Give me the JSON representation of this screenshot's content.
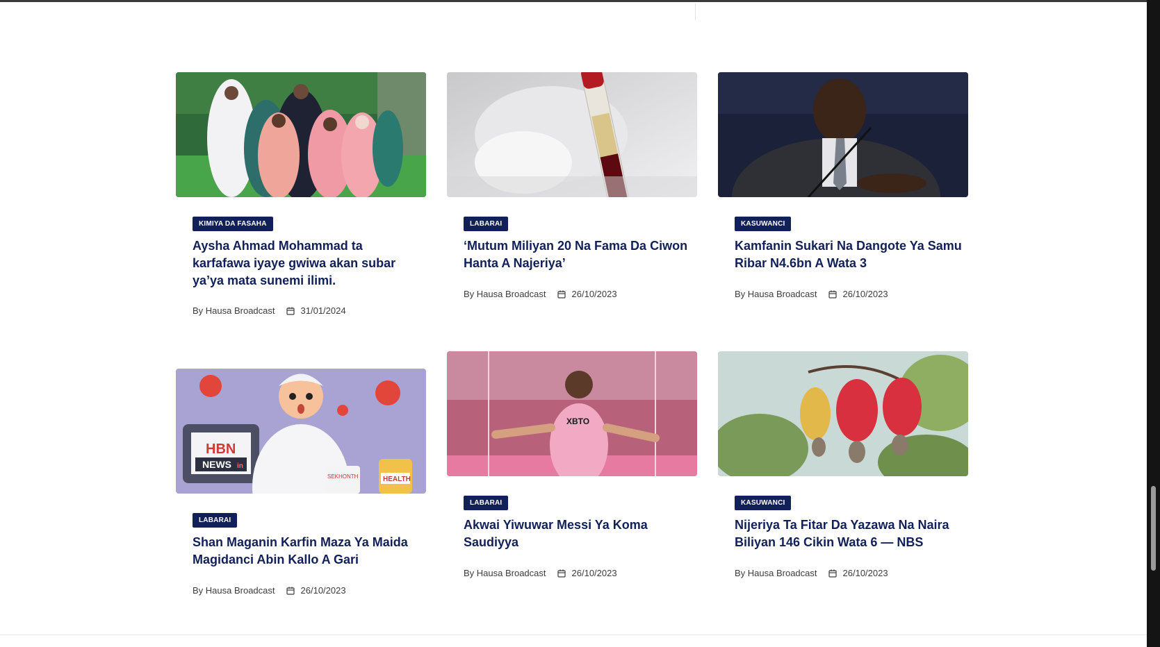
{
  "posts": [
    {
      "category": "KIMIYA DA FASAHA",
      "title": "Aysha Ahmad Mohammad ta karfafawa iyaye gwiwa akan subar ya’ya mata sunemi ilimi.",
      "author": "By Hausa Broadcast",
      "date": "31/01/2024",
      "image": "girls-group-photo"
    },
    {
      "category": "LABARAI",
      "title": "‘Mutum Miliyan 20 Na Fama Da Ciwon Hanta A Najeriya’",
      "author": "By Hausa Broadcast",
      "date": "26/10/2023",
      "image": "blood-test-tube"
    },
    {
      "category": "KASUWANCI",
      "title": "Kamfanin Sukari Na Dangote Ya Samu Ribar N4.6bn A Wata 3",
      "author": "By Hausa Broadcast",
      "date": "26/10/2023",
      "image": "speaker-at-conference"
    },
    {
      "category": "LABARAI",
      "title": "Shan Maganin Karfin Maza Ya Maida Magidanci Abin Kallo A Gari",
      "author": "By Hausa Broadcast",
      "date": "26/10/2023",
      "image": "hbn-news-health-illustration",
      "image_text": {
        "brand": "HBN",
        "news": "NEWS",
        "in": "in",
        "health": "HEALTH",
        "sign": "SEKHONTH"
      }
    },
    {
      "category": "LABARAI",
      "title": "Akwai Yiwuwar Messi Ya Koma Saudiyya",
      "author": "By Hausa Broadcast",
      "date": "26/10/2023",
      "image": "footballer-celebrating",
      "image_text": {
        "shirt": "XBTO"
      }
    },
    {
      "category": "KASUWANCI",
      "title": "Nijeriya Ta Fitar Da Yazawa Na Naira Biliyan 146 Cikin Wata 6 — NBS",
      "author": "By Hausa Broadcast",
      "date": "26/10/2023",
      "image": "cashew-fruits"
    }
  ],
  "colors": {
    "accent": "#12205a",
    "badge_text": "#ffffff",
    "meta_text": "#3c3c3c"
  }
}
